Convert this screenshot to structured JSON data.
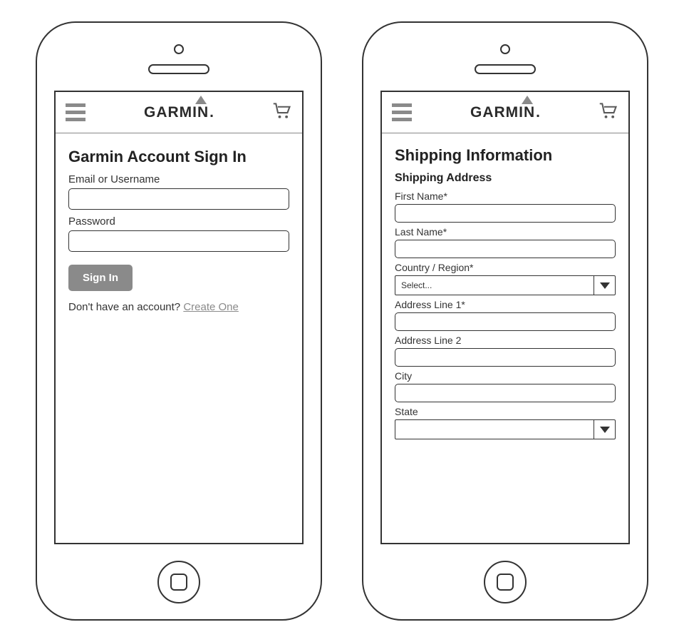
{
  "brand": {
    "name": "GARMIN",
    "dot": "."
  },
  "signin": {
    "title": "Garmin Account Sign In",
    "email_label": "Email or Username",
    "password_label": "Password",
    "button": "Sign In",
    "prompt_text": "Don't have an account? ",
    "create_link": "Create One"
  },
  "shipping": {
    "title": "Shipping Information",
    "subtitle": "Shipping Address",
    "first_name_label": "First Name*",
    "last_name_label": "Last Name*",
    "country_label": "Country / Region*",
    "country_value": "Select...",
    "addr1_label": "Address Line 1*",
    "addr2_label": "Address Line 2",
    "city_label": "City",
    "state_label": "State",
    "state_value": ""
  }
}
